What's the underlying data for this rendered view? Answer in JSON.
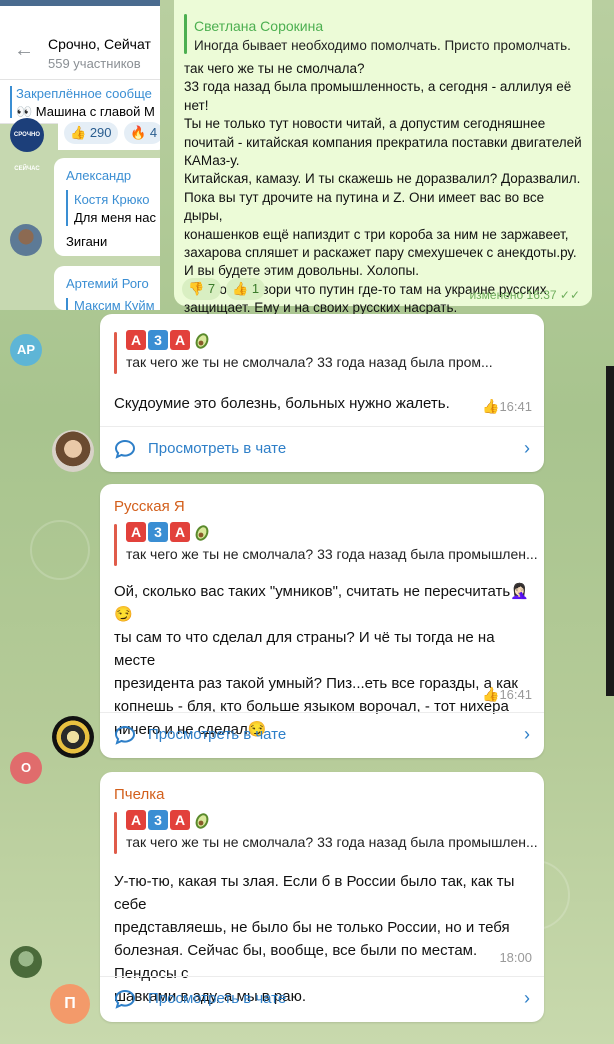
{
  "channel": {
    "title": "Срочно, Сейчат",
    "subtitle": "559 участников",
    "pinned_title": "Закреплённое сообще",
    "pinned_text": "👀 Машина с главой М",
    "avatar_text": "СРОЧНО СЕЙЧАС",
    "reactions": [
      {
        "emoji": "👍",
        "count": "290"
      },
      {
        "emoji": "🔥",
        "count": "4"
      }
    ]
  },
  "side_messages": [
    {
      "author": "Александр",
      "reply_name": "Костя Крюко",
      "reply_text": "Для меня нас",
      "text": "Зигани"
    },
    {
      "author": "Артемий Рого",
      "reply_name": "Максим Куйм"
    }
  ],
  "quoted_message": {
    "quote_author": "Светлана Сорокина",
    "quote_text": "Иногда бывает необходимо помолчать. Присто промолчать.",
    "body": "так чего же ты не смолчала?\n33 года назад была промышленность, а сегодня - аллилуя её нет!\nТы не только тут новости читай, а допустим сегодняшнее\nпочитай - китайская компания прекратила поставки двигателей\nКАМаз-у.\nКитайская, камазу. И ты скажешь не доразвалил? Доразвалил.\nПока вы тут дрочите на путина и Z. Они имеет вас во все дыры,\nконашенков ещё напиздит с три короба за ним не заржавеет,\nзахарова спляшет и раскажет пару смехушечек с анекдоты.ру.\nИ вы будете этим довольны. Холопы.\nТолько не говори что путин где-то там на украине русских\nзащищает. Ему и на своих русских насрать.",
    "reactions": [
      {
        "emoji": "👎",
        "count": "7"
      },
      {
        "emoji": "👍",
        "count": "1"
      }
    ],
    "meta": "изменено 16:37"
  },
  "comments": [
    {
      "avatar_letter": "АР",
      "author": "",
      "reply_prefix": "АЗА",
      "reply_text": "так чего же ты не смолчала? 33 года назад была пром...",
      "body": "Скудоумие это болезнь, больных нужно жалеть.",
      "time": "16:41",
      "view_label": "Просмотреть в чате"
    },
    {
      "avatar_letter": "",
      "author": "Русская Я",
      "reply_prefix": "АЗА",
      "reply_text": "так чего же ты не смолчала? 33 года назад была промышлен...",
      "body": "Ой, сколько вас таких \"умников\", считать не пересчитать🤦🏻‍♀️😏\nты сам то что сделал для страны? И чё ты тогда не на месте\nпрезидента раз такой умный? Пиз...еть все горазды, а как\nкопнешь - бля, кто больше языком ворочал, - тот нихера\nничего и не сделал😏",
      "time": "16:41",
      "view_label": "Просмотреть в чате"
    },
    {
      "avatar_letter": "О",
      "author": "Пчелка",
      "reply_prefix": "АЗА",
      "reply_text": "так чего же ты не смолчала? 33 года назад была промышлен...",
      "body": "У-тю-тю, какая ты злая. Если б в России было так, как ты себе\nпредставляешь, не было бы не только России, но и тебя\nболезная. Сейчас бы, вообще, все были по местам. Пендосы с\nшавками в аду, а мы в раю.",
      "time": "18:00",
      "view_label": "Просмотреть в чате"
    }
  ],
  "extra_avatar_letter": "П",
  "reply_squares": [
    "А",
    "3",
    "А"
  ],
  "colors": {
    "accent_blue": "#2e7fc8",
    "author_orange": "#d35f1b",
    "outgoing_bubble": "#ecfbd7",
    "quote_green": "#4caf50"
  }
}
